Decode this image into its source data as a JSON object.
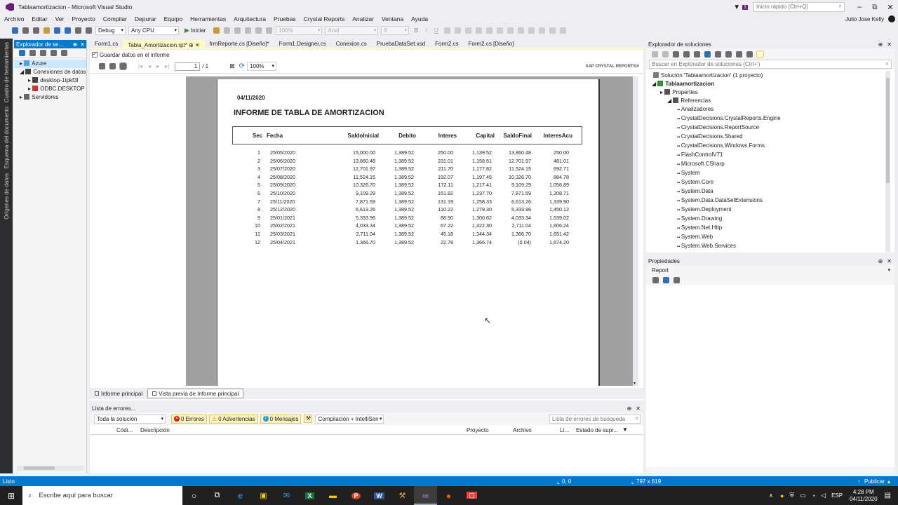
{
  "window": {
    "title": "Tablaamortizacion - Microsoft Visual Studio",
    "quick_launch": "Inicio rápido (Ctrl+Q)",
    "user": "Julio Jose Kelly",
    "notif": "1"
  },
  "menu": [
    "Archivo",
    "Editar",
    "Ver",
    "Proyecto",
    "Compilar",
    "Depurar",
    "Equipo",
    "Herramientas",
    "Arquitectura",
    "Pruebas",
    "Crystal Reports",
    "Analizar",
    "Ventana",
    "Ayuda"
  ],
  "toolbar": {
    "config": "Debug",
    "platform": "Any CPU",
    "start": "Iniciar",
    "zoom": "100%",
    "font": "Arial",
    "fontsize": "9"
  },
  "left_vtabs": [
    "Cuadro de herramientas",
    "Esquema del documento",
    "Orígenes de datos"
  ],
  "server_explorer": {
    "title": "Explorador de se...",
    "nodes": [
      "Azure",
      "Conexiones de datos",
      "desktop-1tpkf3l",
      "ODBC.DESKTOP",
      "Servidores"
    ]
  },
  "doc_tabs": [
    "Form1.cs",
    "Tabla_Amortizacion.rpt*",
    "frmReporte.cs [Diseño]*",
    "Form1.Designer.cs",
    "Conexion.cs",
    "PruebaDataSet.xsd",
    "Form2.cs",
    "Form2.cs [Diseño]"
  ],
  "save_data_label": "Guardar datos en el informe",
  "viewer": {
    "page": "1",
    "page_total": "/ 1",
    "zoom": "100%",
    "brand": "SAP CRYSTAL REPORTS®"
  },
  "report": {
    "date": "04/11/2020",
    "title": "INFORME DE TABLA DE AMORTIZACION",
    "headers": [
      "Sec",
      "Fecha",
      "SaldoInicial",
      "Debito",
      "Interes",
      "Capital",
      "SaldoFinal",
      "InteresAcu"
    ],
    "rows": [
      [
        "1",
        "25/05/2020",
        "15,000.00",
        "1,389.52",
        "250.00",
        "1,139.52",
        "13,860.48",
        "250.00"
      ],
      [
        "2",
        "25/06/2020",
        "13,860.48",
        "1,389.52",
        "231.01",
        "1,158.51",
        "12,701.97",
        "481.01"
      ],
      [
        "3",
        "25/07/2020",
        "12,701.97",
        "1,389.52",
        "211.70",
        "1,177.82",
        "11,524.15",
        "692.71"
      ],
      [
        "4",
        "25/08/2020",
        "11,524.15",
        "1,389.52",
        "192.07",
        "1,197.45",
        "10,326.70",
        "884.78"
      ],
      [
        "5",
        "25/09/2020",
        "10,326.70",
        "1,389.52",
        "172.11",
        "1,217.41",
        "9,109.29",
        "1,056.89"
      ],
      [
        "6",
        "25/10/2020",
        "9,109.29",
        "1,389.52",
        "151.82",
        "1,237.70",
        "7,871.59",
        "1,208.71"
      ],
      [
        "7",
        "25/11/2020",
        "7,871.59",
        "1,389.52",
        "131.19",
        "1,258.33",
        "6,613.26",
        "1,339.90"
      ],
      [
        "8",
        "25/12/2020",
        "6,613.26",
        "1,389.52",
        "110.22",
        "1,279.30",
        "5,333.96",
        "1,450.12"
      ],
      [
        "9",
        "25/01/2021",
        "5,333.96",
        "1,389.52",
        "88.90",
        "1,300.62",
        "4,033.34",
        "1,539.02"
      ],
      [
        "10",
        "25/02/2021",
        "4,033.34",
        "1,389.52",
        "67.22",
        "1,322.30",
        "2,711.04",
        "1,606.24"
      ],
      [
        "11",
        "25/03/2021",
        "2,711.04",
        "1,389.52",
        "45.18",
        "1,344.34",
        "1,366.70",
        "1,651.42"
      ],
      [
        "12",
        "25/04/2021",
        "1,366.70",
        "1,389.52",
        "22.78",
        "1,366.74",
        "(0.04)",
        "1,674.20"
      ]
    ]
  },
  "report_tabs": [
    "Informe principal",
    "Vista previa de Informe principal"
  ],
  "error_list": {
    "title": "Lista de errores...",
    "scope": "Toda la solución",
    "errors": "0 Errores",
    "warnings": "0 Advertencias",
    "messages": "0 Mensajes",
    "build": "Compilación + IntelliSen",
    "search": "Lista de errores de búsqueda",
    "cols": [
      "Códi...",
      "Descripción",
      "Proyecto",
      "Archivo",
      "Lí...",
      "Estado de supr..."
    ]
  },
  "solution_explorer": {
    "title": "Explorador de soluciones",
    "search": "Buscar en Explorador de soluciones (Ctrl+')",
    "solution": "Solución 'Tablaamortizacion' (1 proyecto)",
    "project": "Tablaamortizacion",
    "properties": "Properties",
    "references": "Referencias",
    "refs": [
      "Analizadores",
      "CrystalDecisions.CrystalReports.Engine",
      "CrystalDecisions.ReportSource",
      "CrystalDecisions.Shared",
      "CrystalDecisions.Windows.Forms",
      "FlashControlV71",
      "Microsoft.CSharp",
      "System",
      "System.Core",
      "System.Data",
      "System.Data.DataSetExtensions",
      "System.Deployment",
      "System.Drawing",
      "System.Net.Http",
      "System.Web",
      "System.Web.Services",
      "System.Windows.Forms"
    ]
  },
  "properties": {
    "title": "Propiedades",
    "object": "Report"
  },
  "status": {
    "ready": "Listo",
    "pos": "0, 0",
    "size": "797 x 619",
    "publish": "Publicar"
  },
  "taskbar": {
    "search": "Escribe aquí para buscar",
    "lang": "ESP",
    "time": "4:28 PM",
    "date": "04/11/2020"
  }
}
